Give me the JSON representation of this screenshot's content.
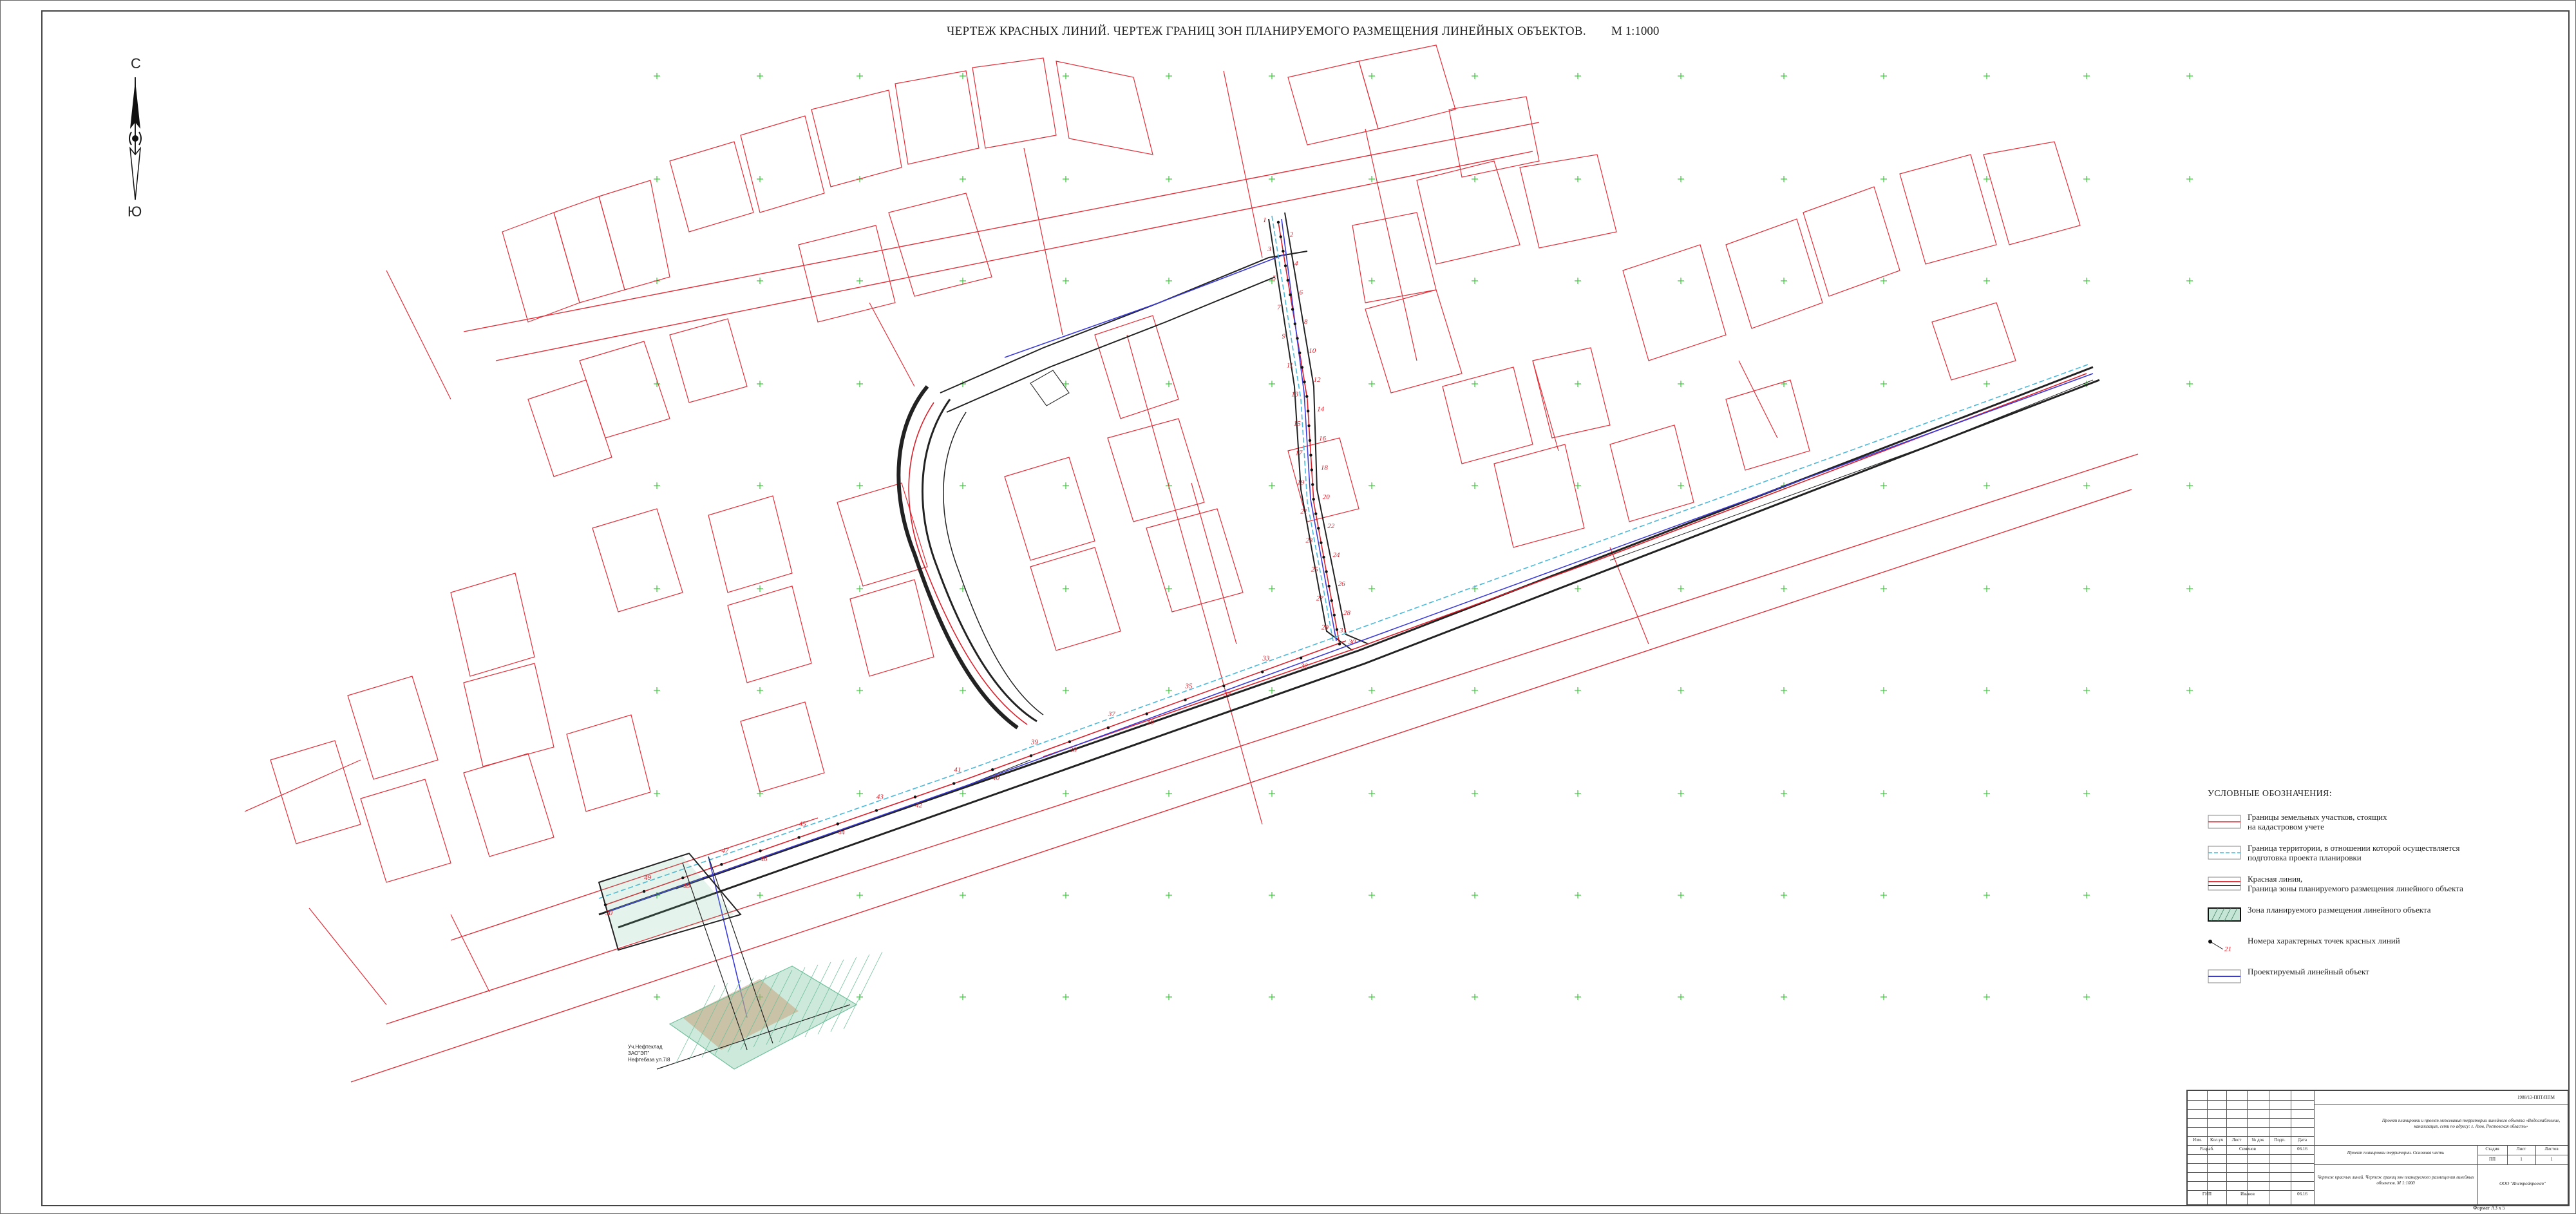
{
  "title": "ЧЕРТЕЖ КРАСНЫХ ЛИНИЙ. ЧЕРТЕЖ ГРАНИЦ ЗОН ПЛАНИРУЕМОГО РАЗМЕЩЕНИЯ ЛИНЕЙНЫХ ОБЪЕКТОВ.",
  "scale": "М 1:1000",
  "north_arrow": {
    "north_letter": "С",
    "south_letter": "Ю",
    "icon": "north-arrow-icon"
  },
  "colors": {
    "parcel": "#e0303a",
    "red_line": "#d81f2a",
    "zone": "#222222",
    "project_object": "#3a3ad8",
    "territory_boundary": "#49b8d9",
    "grid_cross": "#3cc83c",
    "hatch": "#6fbf9a",
    "soil": "#c9a27a"
  },
  "legend": {
    "title": "УСЛОВНЫЕ ОБОЗНАЧЕНИЯ:",
    "items": [
      {
        "key": "parcels",
        "icon": "parcel-boundary-swatch",
        "line1": "Границы земельных участков, стоящих",
        "line2": "на кадастровом учете"
      },
      {
        "key": "territory",
        "icon": "territory-boundary-swatch",
        "line1": "Граница территории, в отношении которой осуществляется",
        "line2": "подготовка проекта планировки"
      },
      {
        "key": "red_line",
        "icon": "red-line-swatch",
        "line1": "Красная линия,",
        "line2": "Граница зоны планируемого размещения линейного объекта"
      },
      {
        "key": "zone",
        "icon": "zone-hatch-swatch",
        "line1": "Зона планируемого размещения линейного объекта",
        "line2": ""
      },
      {
        "key": "points",
        "icon": "point-number-swatch",
        "line1": "Номера характерных точек красных линий",
        "line2": ""
      },
      {
        "key": "object",
        "icon": "project-object-swatch",
        "line1": "Проектируемый линейный объект",
        "line2": ""
      }
    ],
    "point_label": "21"
  },
  "map_labels": {
    "points": [
      "1",
      "2",
      "3",
      "4",
      "5",
      "6",
      "7",
      "8",
      "9",
      "10",
      "11",
      "12",
      "13",
      "14",
      "15",
      "16",
      "17",
      "18",
      "19",
      "20",
      "21",
      "22",
      "23",
      "24",
      "25",
      "26",
      "27",
      "28",
      "29",
      "30",
      "31",
      "32",
      "33",
      "34",
      "35",
      "36",
      "37",
      "38",
      "39",
      "40",
      "41",
      "42",
      "43",
      "44",
      "45",
      "46",
      "47",
      "48",
      "49",
      "50"
    ],
    "note_1": "Уч.Нефтеклад",
    "note_2": "ЗАО\"ЭП\"",
    "note_3": "Нефтебаза ул.7/8"
  },
  "stamp": {
    "doc_code": "1988/13-ППТ/ППМ",
    "project_title": "Проект планировки и проект межевания территории линейного объекта «Водоснабжение, канализация, сети по адресу: г. Азов, Ростовская область»",
    "section": "Проект планировки территории. Основная часть",
    "sheet_title": "Чертеж красных линий. Чертеж границ зон планируемого размещения линейных объектов. М 1:1000",
    "org": "ООО \"Инстройпроект\"",
    "stage_h": "Стадия",
    "sheet_h": "Лист",
    "sheets_h": "Листов",
    "stage": "ПП",
    "sheet": "1",
    "sheets": "1",
    "col_headers": [
      "Изм.",
      "Кол.уч",
      "Лист",
      "№ док",
      "Подп.",
      "Дата"
    ],
    "role_1": "Разраб.",
    "name_1": "Семенов",
    "date_1": "06.16",
    "role_2": "ГИП",
    "name_2": "Иванов",
    "date_2": "06.16",
    "format": "Формат А3 x 5"
  }
}
